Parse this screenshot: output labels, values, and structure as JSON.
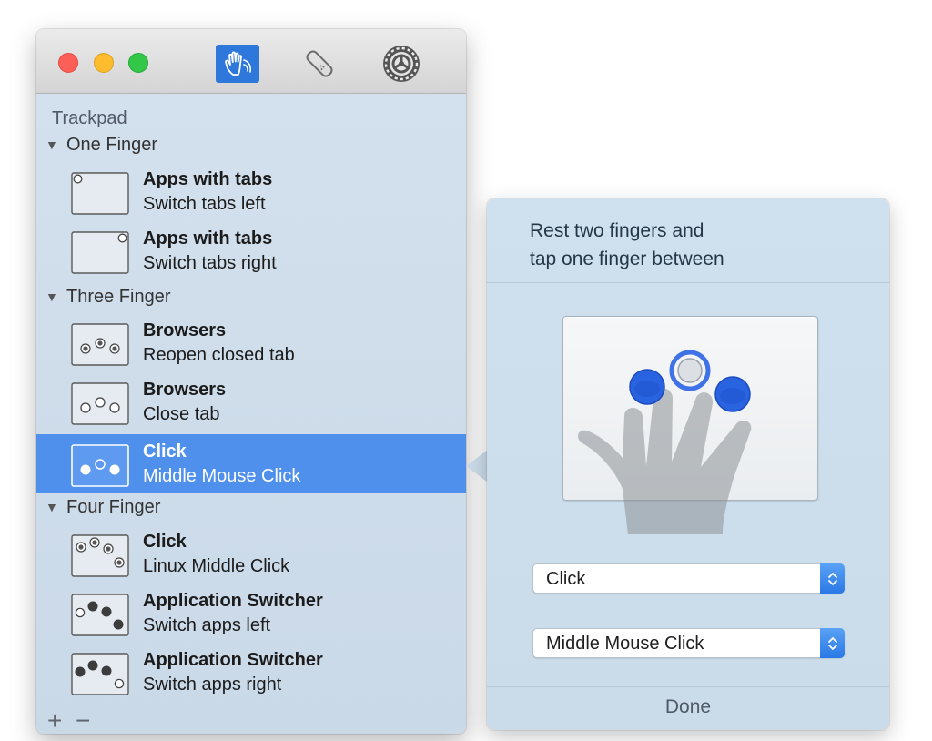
{
  "window": {
    "traffic_lights": [
      "close",
      "minimize",
      "zoom"
    ],
    "toolbar": [
      {
        "icon": "hand-gesture-icon",
        "selected": true
      },
      {
        "icon": "tag-icon",
        "selected": false
      },
      {
        "icon": "gear-icon",
        "selected": false
      }
    ]
  },
  "sidebar": {
    "heading": "Trackpad",
    "groups": [
      {
        "label": "One Finger"
      },
      {
        "label": "Three Finger"
      },
      {
        "label": "Four Finger"
      }
    ],
    "items": [
      {
        "title": "Apps with tabs",
        "subtitle": "Switch tabs left",
        "icon": "one-finger-top-left-icon"
      },
      {
        "title": "Apps with tabs",
        "subtitle": "Switch tabs right",
        "icon": "one-finger-top-right-icon"
      },
      {
        "title": "Browsers",
        "subtitle": "Reopen closed tab",
        "icon": "three-finger-click-icon"
      },
      {
        "title": "Browsers",
        "subtitle": "Close tab",
        "icon": "three-finger-tap-icon"
      },
      {
        "title": "Click",
        "subtitle": "Middle Mouse Click",
        "icon": "three-finger-middle-tap-icon",
        "selected": true
      },
      {
        "title": "Click",
        "subtitle": "Linux Middle Click",
        "icon": "four-finger-click-icon"
      },
      {
        "title": "Application Switcher",
        "subtitle": "Switch apps left",
        "icon": "four-finger-left-icon"
      },
      {
        "title": "Application Switcher",
        "subtitle": "Switch apps right",
        "icon": "four-finger-right-icon"
      }
    ],
    "add_symbol": "+",
    "remove_symbol": "−"
  },
  "popover": {
    "description_line1": "Rest two fingers and",
    "description_line2": "tap one finger between",
    "gesture_select": {
      "value": "Click"
    },
    "action_select": {
      "value": "Middle Mouse Click"
    },
    "done_label": "Done"
  },
  "colors": {
    "accent": "#4f90ec",
    "toolbar_selected": "#2d78da",
    "sidebar_bg": "#d4e1ee",
    "touch_point": "#1f5fe0"
  }
}
